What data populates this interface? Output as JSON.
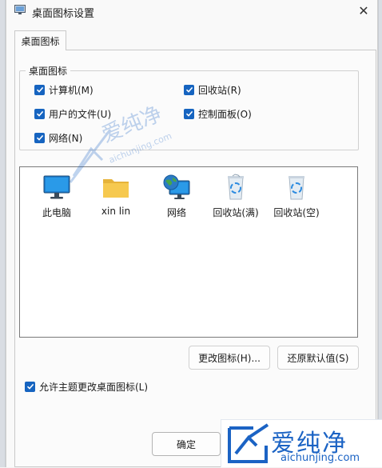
{
  "window": {
    "title": "桌面图标设置"
  },
  "tab": {
    "label": "桌面图标"
  },
  "group": {
    "legend": "桌面图标",
    "checkboxes": [
      {
        "label": "计算机(M)",
        "checked": true
      },
      {
        "label": "回收站(R)",
        "checked": true
      },
      {
        "label": "用户的文件(U)",
        "checked": true
      },
      {
        "label": "控制面板(O)",
        "checked": true
      },
      {
        "label": "网络(N)",
        "checked": true
      }
    ]
  },
  "icons": [
    {
      "label": "此电脑",
      "icon": "monitor-icon"
    },
    {
      "label": "xin lin",
      "icon": "folder-icon"
    },
    {
      "label": "网络",
      "icon": "network-globe-icon"
    },
    {
      "label": "回收站(满)",
      "icon": "recycle-bin-full-icon"
    },
    {
      "label": "回收站(空)",
      "icon": "recycle-bin-empty-icon"
    }
  ],
  "buttons": {
    "change_icon": "更改图标(H)...",
    "restore_default": "还原默认值(S)",
    "ok": "确定"
  },
  "allow_themes": {
    "label": "允许主题更改桌面图标(L)",
    "checked": true
  },
  "watermark": {
    "text_cn": "爱纯净",
    "url": "aichunjing.com"
  },
  "colors": {
    "accent": "#1664c0",
    "watermark": "#1b63c4"
  }
}
